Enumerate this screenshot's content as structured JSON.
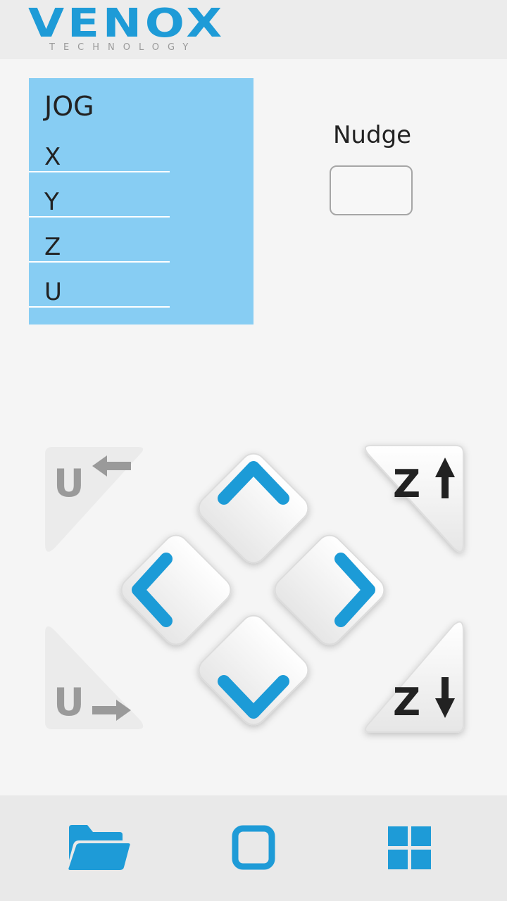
{
  "header": {
    "logo_text": "VENOX",
    "logo_subtext": "TECHNOLOGY"
  },
  "jog": {
    "title": "JOG",
    "axes": [
      "X",
      "Y",
      "Z",
      "U"
    ]
  },
  "nudge": {
    "label": "Nudge",
    "value": ""
  },
  "pad": {
    "u_left_label": "U",
    "u_right_label": "U",
    "z_up_label": "Z",
    "z_down_label": "Z"
  },
  "colors": {
    "accent": "#1e9bd7",
    "jog_panel": "#87cdf3",
    "disabled": "#9a9a9a",
    "dark": "#222222"
  },
  "bottom_nav": {
    "items": [
      "folder-icon",
      "square-icon",
      "grid-icon"
    ]
  }
}
